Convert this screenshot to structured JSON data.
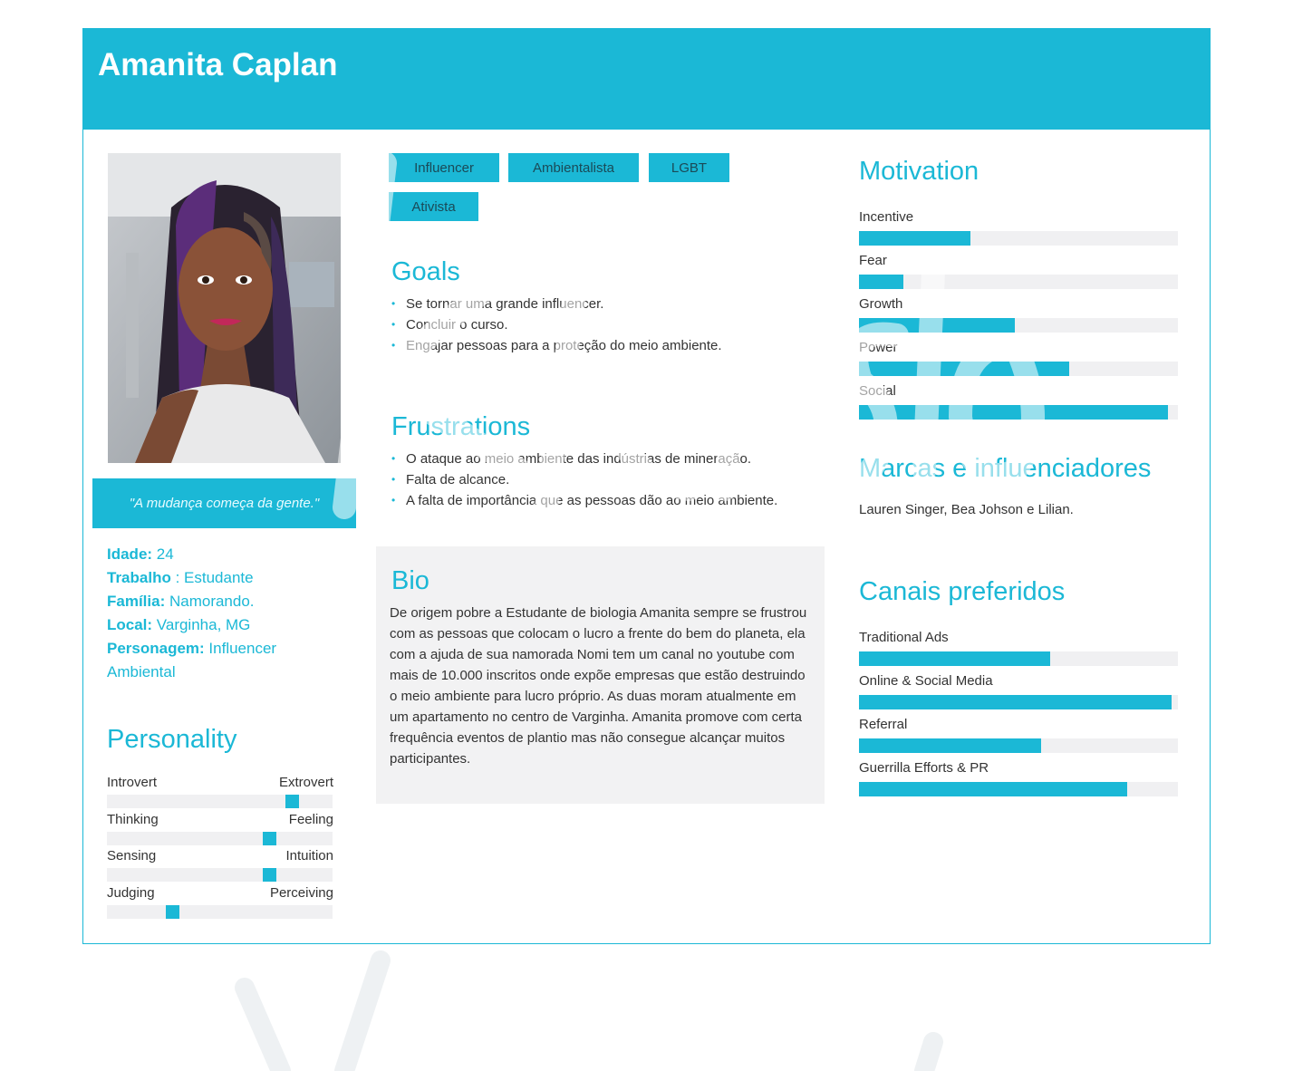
{
  "persona": {
    "name": "Amanita Caplan",
    "quote": "\"A mudança começa da gente.\""
  },
  "demographics": [
    {
      "label": "Idade:",
      "value": " 24"
    },
    {
      "label": "Trabalho",
      "value": " : Estudante"
    },
    {
      "label": "Família:",
      "value": " Namorando."
    },
    {
      "label": "Local:",
      "value": " Varginha, MG"
    },
    {
      "label": "Personagem:",
      "value": " Influencer Ambiental"
    }
  ],
  "personality": {
    "title": "Personality",
    "traits": [
      {
        "left": "Introvert",
        "right": "Extrovert",
        "position": 0.82
      },
      {
        "left": "Thinking",
        "right": "Feeling",
        "position": 0.72
      },
      {
        "left": "Sensing",
        "right": "Intuition",
        "position": 0.72
      },
      {
        "left": "Judging",
        "right": "Perceiving",
        "position": 0.29
      }
    ]
  },
  "tags": [
    "Influencer",
    "Ambientalista",
    "LGBT",
    "Ativista"
  ],
  "goals": {
    "title": "Goals",
    "items": [
      "Se tornar uma grande influencer.",
      "Concluir o curso.",
      "Engajar pessoas para a proteção do meio ambiente."
    ]
  },
  "frustrations": {
    "title": "Frustrations",
    "items": [
      "O ataque ao meio ambiente das indústrias de mineração.",
      "Falta de alcance.",
      "A falta de importância que as pessoas dão ao meio ambiente."
    ]
  },
  "bio": {
    "title": "Bio",
    "text": "De origem pobre a Estudante de biologia Amanita sempre se frustrou com as pessoas que colocam o lucro a frente do bem do planeta, ela com a ajuda de sua namorada Nomi tem um canal no youtube com mais de 10.000 inscritos onde expõe empresas que estão destruindo o meio ambiente para lucro próprio. As duas moram atualmente em um apartamento no centro de Varginha. Amanita promove com certa frequência eventos de plantio mas não consegue alcançar muitos participantes."
  },
  "motivation": {
    "title": "Motivation",
    "items": [
      {
        "label": "Incentive",
        "value": 0.35
      },
      {
        "label": "Fear",
        "value": 0.14
      },
      {
        "label": "Growth",
        "value": 0.49
      },
      {
        "label": "Power",
        "value": 0.66
      },
      {
        "label": "Social",
        "value": 0.97
      }
    ]
  },
  "brands": {
    "title": "Marcas e influenciadores",
    "text": "Lauren Singer, Bea Johson e Lilian."
  },
  "channels": {
    "title": "Canais preferidos",
    "items": [
      {
        "label": "Traditional Ads",
        "value": 0.6
      },
      {
        "label": "Online & Social Media",
        "value": 0.98
      },
      {
        "label": "Referral",
        "value": 0.57
      },
      {
        "label": "Guerrilla Efforts & PR",
        "value": 0.84
      }
    ]
  },
  "colors": {
    "accent": "#1bb8d6",
    "track": "#f0f0f2",
    "bio_bg": "#f2f2f3"
  }
}
